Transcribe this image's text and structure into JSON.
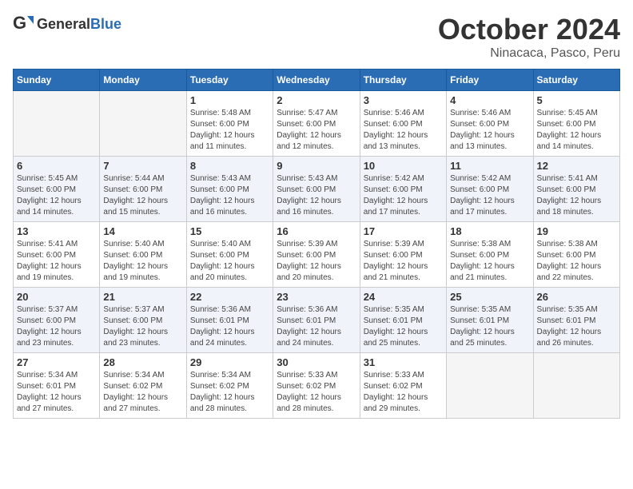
{
  "header": {
    "logo_general": "General",
    "logo_blue": "Blue",
    "month": "October 2024",
    "location": "Ninacaca, Pasco, Peru"
  },
  "weekdays": [
    "Sunday",
    "Monday",
    "Tuesday",
    "Wednesday",
    "Thursday",
    "Friday",
    "Saturday"
  ],
  "weeks": [
    [
      {
        "day": "",
        "empty": true
      },
      {
        "day": "",
        "empty": true
      },
      {
        "day": "1",
        "sunrise": "5:48 AM",
        "sunset": "6:00 PM",
        "daylight": "12 hours and 11 minutes."
      },
      {
        "day": "2",
        "sunrise": "5:47 AM",
        "sunset": "6:00 PM",
        "daylight": "12 hours and 12 minutes."
      },
      {
        "day": "3",
        "sunrise": "5:46 AM",
        "sunset": "6:00 PM",
        "daylight": "12 hours and 13 minutes."
      },
      {
        "day": "4",
        "sunrise": "5:46 AM",
        "sunset": "6:00 PM",
        "daylight": "12 hours and 13 minutes."
      },
      {
        "day": "5",
        "sunrise": "5:45 AM",
        "sunset": "6:00 PM",
        "daylight": "12 hours and 14 minutes."
      }
    ],
    [
      {
        "day": "6",
        "sunrise": "5:45 AM",
        "sunset": "6:00 PM",
        "daylight": "12 hours and 14 minutes."
      },
      {
        "day": "7",
        "sunrise": "5:44 AM",
        "sunset": "6:00 PM",
        "daylight": "12 hours and 15 minutes."
      },
      {
        "day": "8",
        "sunrise": "5:43 AM",
        "sunset": "6:00 PM",
        "daylight": "12 hours and 16 minutes."
      },
      {
        "day": "9",
        "sunrise": "5:43 AM",
        "sunset": "6:00 PM",
        "daylight": "12 hours and 16 minutes."
      },
      {
        "day": "10",
        "sunrise": "5:42 AM",
        "sunset": "6:00 PM",
        "daylight": "12 hours and 17 minutes."
      },
      {
        "day": "11",
        "sunrise": "5:42 AM",
        "sunset": "6:00 PM",
        "daylight": "12 hours and 17 minutes."
      },
      {
        "day": "12",
        "sunrise": "5:41 AM",
        "sunset": "6:00 PM",
        "daylight": "12 hours and 18 minutes."
      }
    ],
    [
      {
        "day": "13",
        "sunrise": "5:41 AM",
        "sunset": "6:00 PM",
        "daylight": "12 hours and 19 minutes."
      },
      {
        "day": "14",
        "sunrise": "5:40 AM",
        "sunset": "6:00 PM",
        "daylight": "12 hours and 19 minutes."
      },
      {
        "day": "15",
        "sunrise": "5:40 AM",
        "sunset": "6:00 PM",
        "daylight": "12 hours and 20 minutes."
      },
      {
        "day": "16",
        "sunrise": "5:39 AM",
        "sunset": "6:00 PM",
        "daylight": "12 hours and 20 minutes."
      },
      {
        "day": "17",
        "sunrise": "5:39 AM",
        "sunset": "6:00 PM",
        "daylight": "12 hours and 21 minutes."
      },
      {
        "day": "18",
        "sunrise": "5:38 AM",
        "sunset": "6:00 PM",
        "daylight": "12 hours and 21 minutes."
      },
      {
        "day": "19",
        "sunrise": "5:38 AM",
        "sunset": "6:00 PM",
        "daylight": "12 hours and 22 minutes."
      }
    ],
    [
      {
        "day": "20",
        "sunrise": "5:37 AM",
        "sunset": "6:00 PM",
        "daylight": "12 hours and 23 minutes."
      },
      {
        "day": "21",
        "sunrise": "5:37 AM",
        "sunset": "6:00 PM",
        "daylight": "12 hours and 23 minutes."
      },
      {
        "day": "22",
        "sunrise": "5:36 AM",
        "sunset": "6:01 PM",
        "daylight": "12 hours and 24 minutes."
      },
      {
        "day": "23",
        "sunrise": "5:36 AM",
        "sunset": "6:01 PM",
        "daylight": "12 hours and 24 minutes."
      },
      {
        "day": "24",
        "sunrise": "5:35 AM",
        "sunset": "6:01 PM",
        "daylight": "12 hours and 25 minutes."
      },
      {
        "day": "25",
        "sunrise": "5:35 AM",
        "sunset": "6:01 PM",
        "daylight": "12 hours and 25 minutes."
      },
      {
        "day": "26",
        "sunrise": "5:35 AM",
        "sunset": "6:01 PM",
        "daylight": "12 hours and 26 minutes."
      }
    ],
    [
      {
        "day": "27",
        "sunrise": "5:34 AM",
        "sunset": "6:01 PM",
        "daylight": "12 hours and 27 minutes."
      },
      {
        "day": "28",
        "sunrise": "5:34 AM",
        "sunset": "6:02 PM",
        "daylight": "12 hours and 27 minutes."
      },
      {
        "day": "29",
        "sunrise": "5:34 AM",
        "sunset": "6:02 PM",
        "daylight": "12 hours and 28 minutes."
      },
      {
        "day": "30",
        "sunrise": "5:33 AM",
        "sunset": "6:02 PM",
        "daylight": "12 hours and 28 minutes."
      },
      {
        "day": "31",
        "sunrise": "5:33 AM",
        "sunset": "6:02 PM",
        "daylight": "12 hours and 29 minutes."
      },
      {
        "day": "",
        "empty": true
      },
      {
        "day": "",
        "empty": true
      }
    ]
  ]
}
